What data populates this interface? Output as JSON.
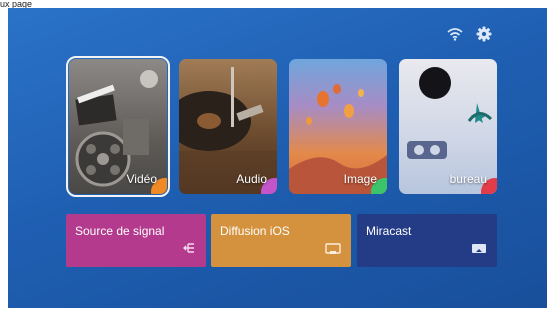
{
  "header": {
    "caption": "ux page"
  },
  "status": {
    "wifi_icon": "wifi-icon",
    "settings_icon": "gear-icon"
  },
  "tiles": [
    {
      "label": "Vidéo",
      "color": "#6d6a66",
      "accent": "#f08a24",
      "selected": true
    },
    {
      "label": "Audio",
      "color": "#7a5a3b",
      "accent": "#c454c9"
    },
    {
      "label": "Image",
      "color": "#d8823a",
      "accent": "#3cc46a"
    },
    {
      "label": "bureau",
      "color": "#dde0ea",
      "accent": "#e23c4a"
    }
  ],
  "actions": [
    {
      "label": "Source de signal",
      "color": "#b33a8c",
      "icon": "signal-source-icon"
    },
    {
      "label": "Diffusion iOS",
      "color": "#d4923e",
      "icon": "screen-mirror-icon"
    },
    {
      "label": "Miracast",
      "color": "#243c86",
      "icon": "cast-screen-icon"
    }
  ]
}
